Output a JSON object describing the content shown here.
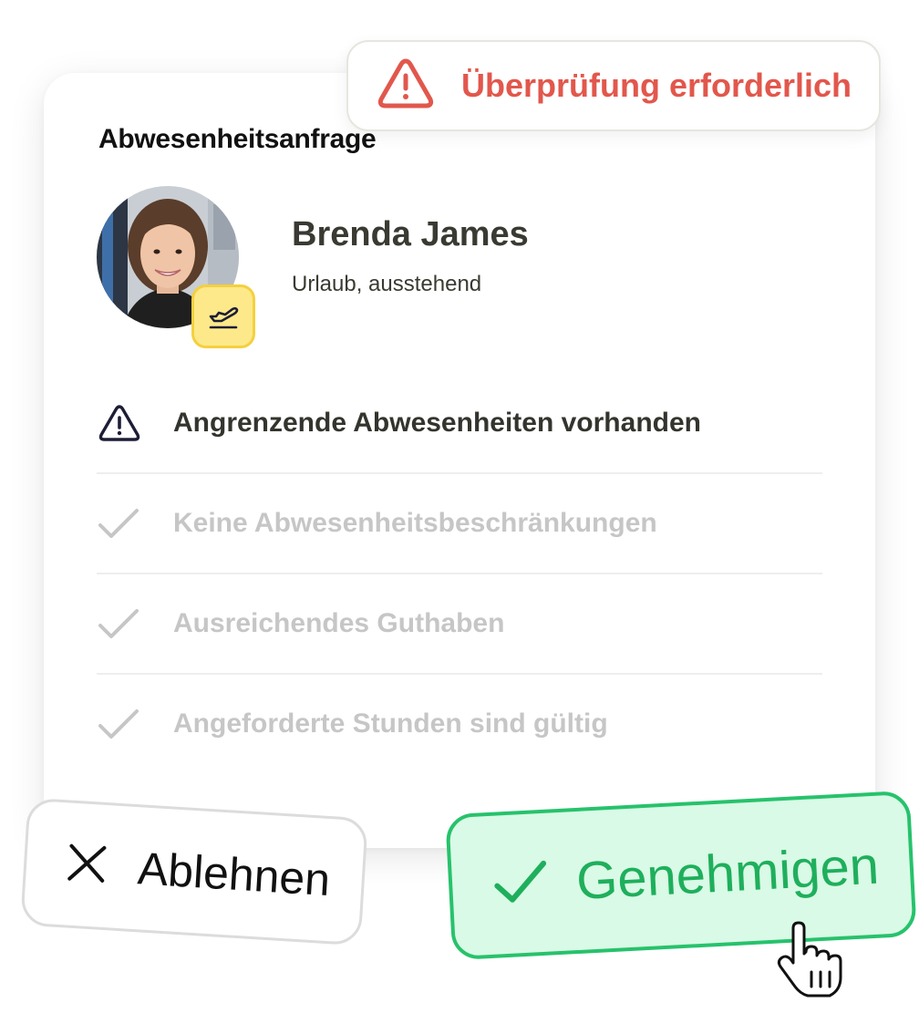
{
  "review_alert": {
    "label": "Überprüfung erforderlich",
    "icon": "warning-triangle-icon",
    "color": "#E2574C"
  },
  "card": {
    "title": "Abwesenheitsanfrage",
    "employee": {
      "name": "Brenda James",
      "status": "Urlaub, ausstehend",
      "badge_icon": "airplane-departure-icon"
    },
    "checks": [
      {
        "label": "Angrenzende Abwesenheiten vorhanden",
        "state": "warning",
        "icon": "warning-triangle-icon"
      },
      {
        "label": "Keine Abwesenheitsbeschränkungen",
        "state": "ok",
        "icon": "check-icon"
      },
      {
        "label": "Ausreichendes Guthaben",
        "state": "ok",
        "icon": "check-icon"
      },
      {
        "label": "Angeforderte Stunden sind gültig",
        "state": "ok",
        "icon": "check-icon"
      }
    ]
  },
  "actions": {
    "reject_label": "Ablehnen",
    "approve_label": "Genehmigen"
  },
  "colors": {
    "approve_border": "#27C26C",
    "approve_fill": "#D9FAE6",
    "badge_fill": "#FDE98A"
  }
}
